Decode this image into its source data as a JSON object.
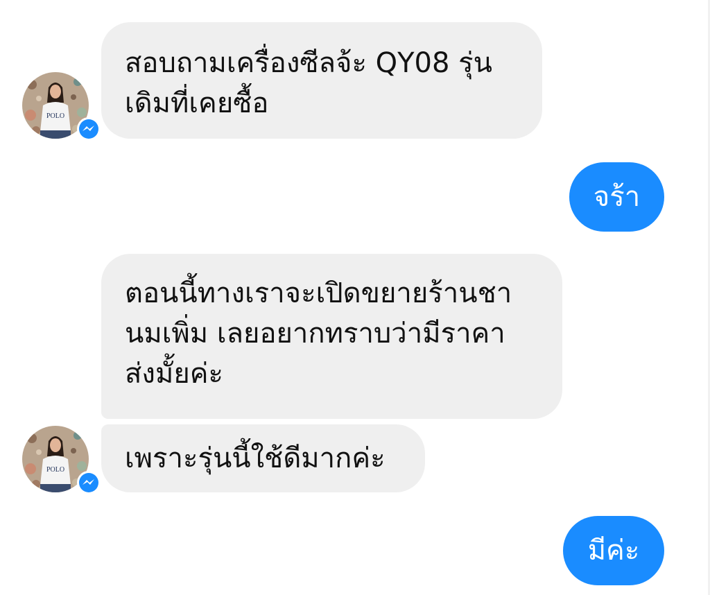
{
  "messages": [
    {
      "sender": "incoming",
      "lines": [
        "สอบถามเครื่องซีลจ้ะ QY08 รุ่น",
        "เดิมที่เคยซื้อ"
      ]
    },
    {
      "sender": "outgoing",
      "lines": [
        "จร้า"
      ]
    },
    {
      "sender": "incoming",
      "lines": [
        "ตอนนี้ทางเราจะเปิดขยายร้านชา",
        "นมเพิ่ม เลยอยากทราบว่ามีราคา",
        "ส่งมั้ยค่ะ"
      ]
    },
    {
      "sender": "incoming",
      "lines": [
        "เพราะรุ่นนี้ใช้ดีมากค่ะ"
      ]
    },
    {
      "sender": "outgoing",
      "lines": [
        "มีค่ะ"
      ]
    }
  ],
  "avatar_shirt_text": "POLO",
  "colors": {
    "incoming_bubble": "#efefef",
    "outgoing_bubble": "#1a8cff",
    "messenger_badge": "#1a8cff",
    "text_dark": "#111111",
    "text_light": "#ffffff"
  },
  "icons": {
    "badge": "messenger-bolt-icon",
    "avatar": "user-avatar"
  }
}
